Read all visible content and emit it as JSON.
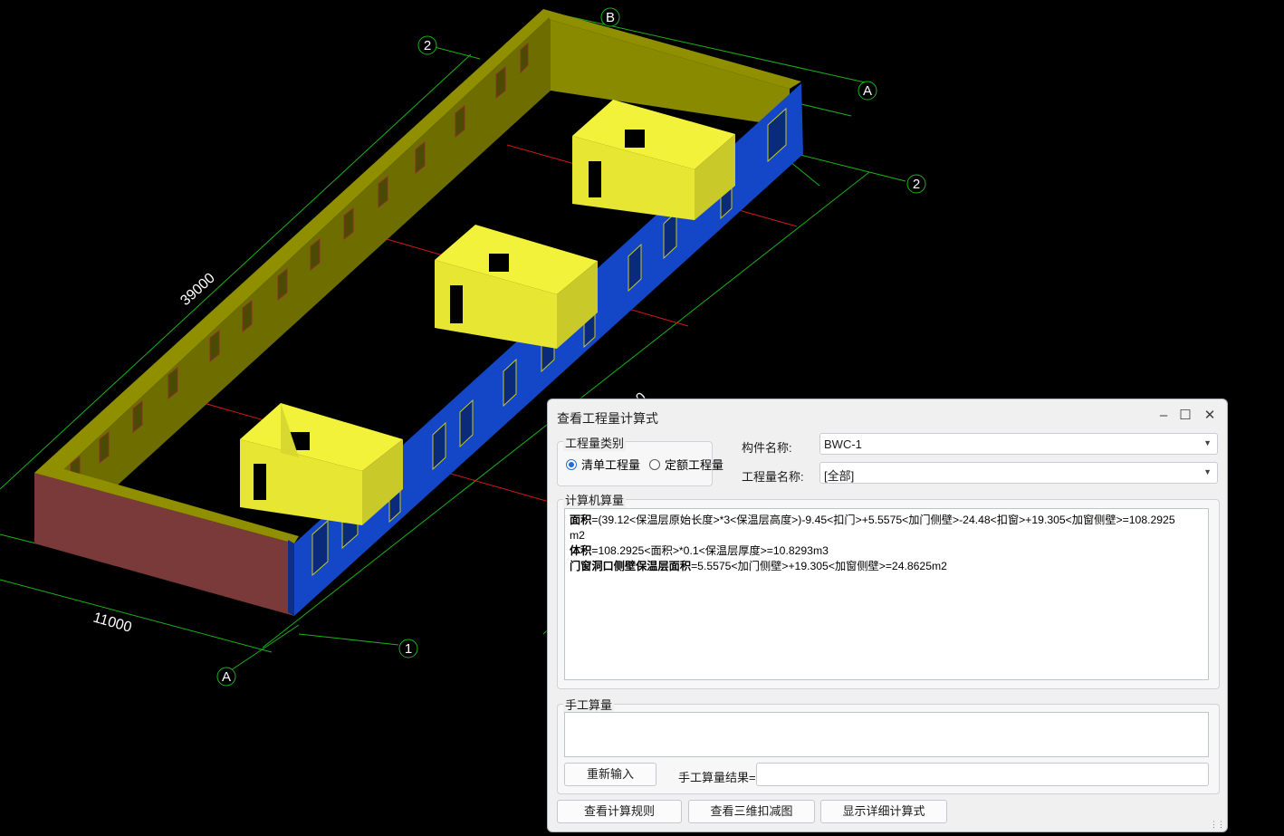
{
  "viewport": {
    "dimensions": {
      "length": "39000",
      "width": "11000",
      "partial": "0"
    },
    "grid_axes": {
      "top_b": "B",
      "top_2": "2",
      "right_a": "A",
      "right_2": "2",
      "bottom_a": "A",
      "bottom_1": "1"
    },
    "colors": {
      "outer_wall_top": "#7a7a00",
      "outer_wall_side": "#6b6b00",
      "end_wall": "#7a3a3a",
      "insulation_wall": "#1447c7",
      "inner_room": "#e6e633",
      "grid_line": "#19b319"
    }
  },
  "dialog": {
    "title": "查看工程量计算式",
    "category_legend": "工程量类别",
    "radio_bill": "清单工程量",
    "radio_quota": "定额工程量",
    "component_label": "构件名称:",
    "component_value": "BWC-1",
    "quantity_label": "工程量名称:",
    "quantity_value": "[全部]",
    "computer_legend": "计算机算量",
    "calc": {
      "l1_bold": "面积",
      "l1_rest": "=(39.12<保温层原始长度>*3<保温层高度>)-9.45<扣门>+5.5575<加门侧壁>-24.48<扣窗>+19.305<加窗侧壁>=108.2925",
      "l1_cont": "m2",
      "l2_bold": "体积",
      "l2_rest": "=108.2925<面积>*0.1<保温层厚度>=10.8293m3",
      "l3_bold": "门窗洞口侧壁保温层面积",
      "l3_rest": "=5.5575<加门侧壁>+19.305<加窗侧壁>=24.8625m2"
    },
    "manual_legend": "手工算量",
    "reinput_button": "重新输入",
    "manual_result_label": "手工算量结果=",
    "rules_button": "查看计算规则",
    "view3d_button": "查看三维扣减图",
    "detail_button": "显示详细计算式"
  }
}
